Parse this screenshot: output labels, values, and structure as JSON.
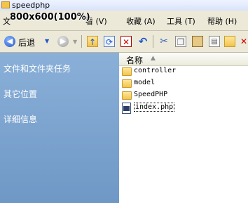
{
  "window": {
    "title": "speedphp"
  },
  "overlay": {
    "zoom_text": "800x600(100%)"
  },
  "menubar": {
    "items": [
      {
        "label": "文"
      },
      {
        "label": "看 (V)"
      },
      {
        "label": "收藏 (A)"
      },
      {
        "label": "工具 (T)"
      },
      {
        "label": "帮助 (H)"
      }
    ]
  },
  "toolbar": {
    "back_label": "后退",
    "icons": [
      "back-icon",
      "forward-icon",
      "up-folder-icon",
      "sync-icon",
      "delete-icon",
      "undo-icon",
      "cut-icon",
      "copy-icon",
      "paste-icon",
      "properties-icon",
      "folder-icon",
      "close-icon"
    ]
  },
  "sidebar": {
    "items": [
      {
        "label": "文件和文件夹任务"
      },
      {
        "label": "其它位置"
      },
      {
        "label": "详细信息"
      }
    ]
  },
  "filelist": {
    "column_header": "名称",
    "files": [
      {
        "name": "controller",
        "type": "folder"
      },
      {
        "name": "model",
        "type": "folder"
      },
      {
        "name": "SpeedPHP",
        "type": "folder"
      },
      {
        "name": "index.php",
        "type": "php"
      }
    ]
  },
  "colors": {
    "sidebar": "#7fa6d2",
    "toolbar": "#ece9d8",
    "folder": "#f2c44c",
    "accent": "#1f56c8"
  }
}
